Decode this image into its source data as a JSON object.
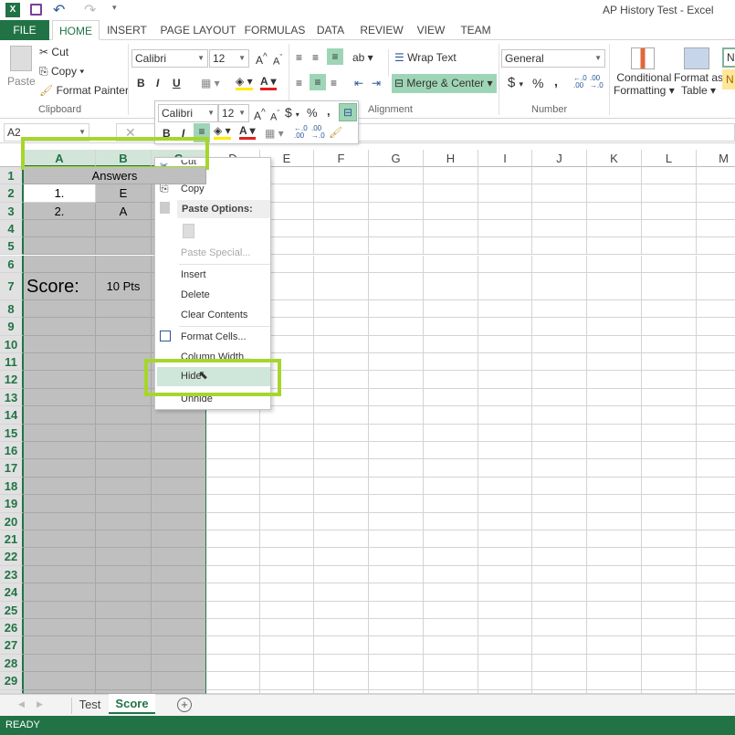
{
  "window": {
    "title": "AP History Test - Excel"
  },
  "quick_access": {
    "icons": [
      "excel-logo-icon",
      "save-icon",
      "undo-icon",
      "redo-icon",
      "customize-icon"
    ]
  },
  "ribbon_tabs": [
    "FILE",
    "HOME",
    "INSERT",
    "PAGE LAYOUT",
    "FORMULAS",
    "DATA",
    "REVIEW",
    "VIEW",
    "TEAM"
  ],
  "clipboard": {
    "paste": "Paste",
    "cut": "Cut",
    "copy": "Copy",
    "format_painter": "Format Painter",
    "label": "Clipboard"
  },
  "font": {
    "name": "Calibri",
    "size": "12",
    "bold": "B",
    "italic": "I",
    "underline": "U"
  },
  "alignment": {
    "wrap_text": "Wrap Text",
    "merge_center": "Merge & Center",
    "label": "Alignment"
  },
  "number": {
    "format": "General",
    "currency": "$",
    "percent": "%",
    "comma": ",",
    "label": "Number"
  },
  "styles": {
    "conditional": "Conditional",
    "conditional2": "Formatting",
    "format_as": "Format as",
    "format_as2": "Table",
    "style_normal": "N",
    "style_neutral": "N"
  },
  "formula_bar": {
    "name_box": "A2",
    "cancel": "✕"
  },
  "columns": [
    "A",
    "B",
    "C",
    "D",
    "E",
    "F",
    "G",
    "H",
    "I",
    "J",
    "K",
    "L",
    "M"
  ],
  "selected_columns": [
    "A",
    "B",
    "C"
  ],
  "cells": {
    "B1": "Answers",
    "A2": "1.",
    "B2": "E",
    "A3": "2.",
    "B3": "A",
    "A7": "Score:",
    "B7": "10 Pts"
  },
  "mini_toolbar": {
    "font": "Calibri",
    "size": "12",
    "currency": "$",
    "percent": "%",
    "comma": ",",
    "bold": "B",
    "italic": "I"
  },
  "context_menu": {
    "cut": "Cut",
    "copy": "Copy",
    "paste_options": "Paste Options:",
    "paste_special": "Paste Special...",
    "insert": "Insert",
    "delete": "Delete",
    "clear_contents": "Clear Contents",
    "format_cells": "Format Cells...",
    "column_width": "Column Width...",
    "hide": "Hide",
    "unhide": "Unhide"
  },
  "sheets": {
    "tabs": [
      "Test",
      "Score"
    ],
    "active": "Score"
  },
  "status": {
    "text": "READY"
  },
  "colors": {
    "accent": "#217346",
    "highlight": "#a6d62b",
    "selection": "#bfbfbf"
  }
}
